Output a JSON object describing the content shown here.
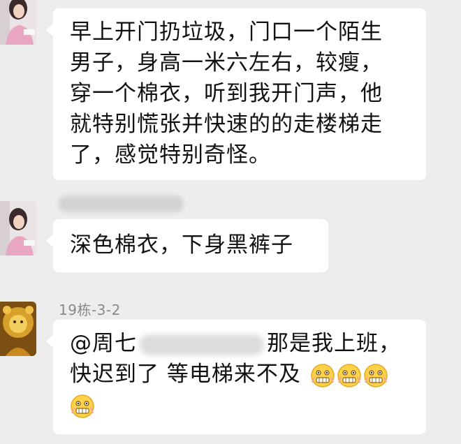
{
  "messages": [
    {
      "text_lines": [
        "早上开门扔垃圾，门口一个陌生",
        "男子，身高一米六左右，较瘦，",
        "穿一个棉衣，听到我开门声，他",
        "就特别慌张并快速的的走楼梯走",
        "了，感觉特别奇怪。"
      ]
    },
    {
      "text": "深色棉衣，下身黑裤子"
    },
    {
      "sender": "19栋-3-2",
      "line1_start": "@周七",
      "line1_end": "那是我上班，",
      "line2_text": "快迟到了 等电梯来不及",
      "emoji_icon": "grimacing-emoji"
    }
  ]
}
